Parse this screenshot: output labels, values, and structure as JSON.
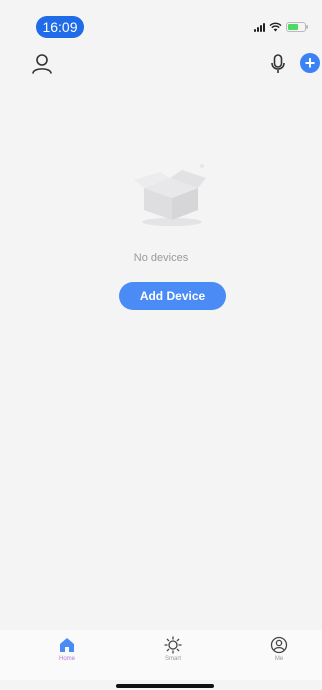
{
  "status_bar": {
    "time": "16:09"
  },
  "top_bar": {
    "profile_icon": "person-icon",
    "mic_icon": "microphone-icon",
    "add_icon": "plus-icon",
    "add_symbol": "+"
  },
  "empty_state": {
    "message": "No devices",
    "button_label": "Add Device"
  },
  "tabs": [
    {
      "label": "Home",
      "icon": "home-icon",
      "active": true
    },
    {
      "label": "Smart",
      "icon": "sun-icon",
      "active": false
    },
    {
      "label": "Me",
      "icon": "user-circle-icon",
      "active": false
    }
  ],
  "colors": {
    "accent": "#4a8bf5",
    "time_pill": "#1f6be8",
    "active_tab": "#b07ad8"
  }
}
